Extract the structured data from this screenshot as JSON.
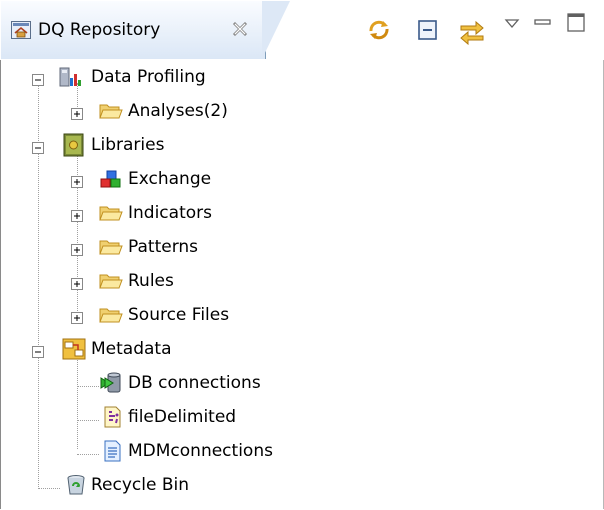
{
  "view": {
    "title": "DQ Repository",
    "toolbar": [
      "sync-icon",
      "collapse-all-icon",
      "link-with-editor-icon",
      "view-menu-icon",
      "minimize-icon",
      "maximize-icon"
    ]
  },
  "tree": [
    {
      "label": "Data Profiling",
      "icon": "data-profiling-icon",
      "expanded": true
    },
    {
      "label": "Analyses(2)",
      "icon": "folder-icon",
      "expanded": false
    },
    {
      "label": "Libraries",
      "icon": "libraries-icon",
      "expanded": true
    },
    {
      "label": "Exchange",
      "icon": "exchange-icon",
      "expanded": false
    },
    {
      "label": "Indicators",
      "icon": "folder-icon",
      "expanded": false
    },
    {
      "label": "Patterns",
      "icon": "folder-icon",
      "expanded": false
    },
    {
      "label": "Rules",
      "icon": "folder-icon",
      "expanded": false
    },
    {
      "label": "Source Files",
      "icon": "folder-icon",
      "expanded": false
    },
    {
      "label": "Metadata",
      "icon": "metadata-icon",
      "expanded": true
    },
    {
      "label": "DB connections",
      "icon": "db-connections-icon"
    },
    {
      "label": "fileDelimited",
      "icon": "file-delimited-icon"
    },
    {
      "label": "MDMconnections",
      "icon": "mdm-connections-icon"
    },
    {
      "label": "Recycle Bin",
      "icon": "recycle-bin-icon"
    }
  ]
}
